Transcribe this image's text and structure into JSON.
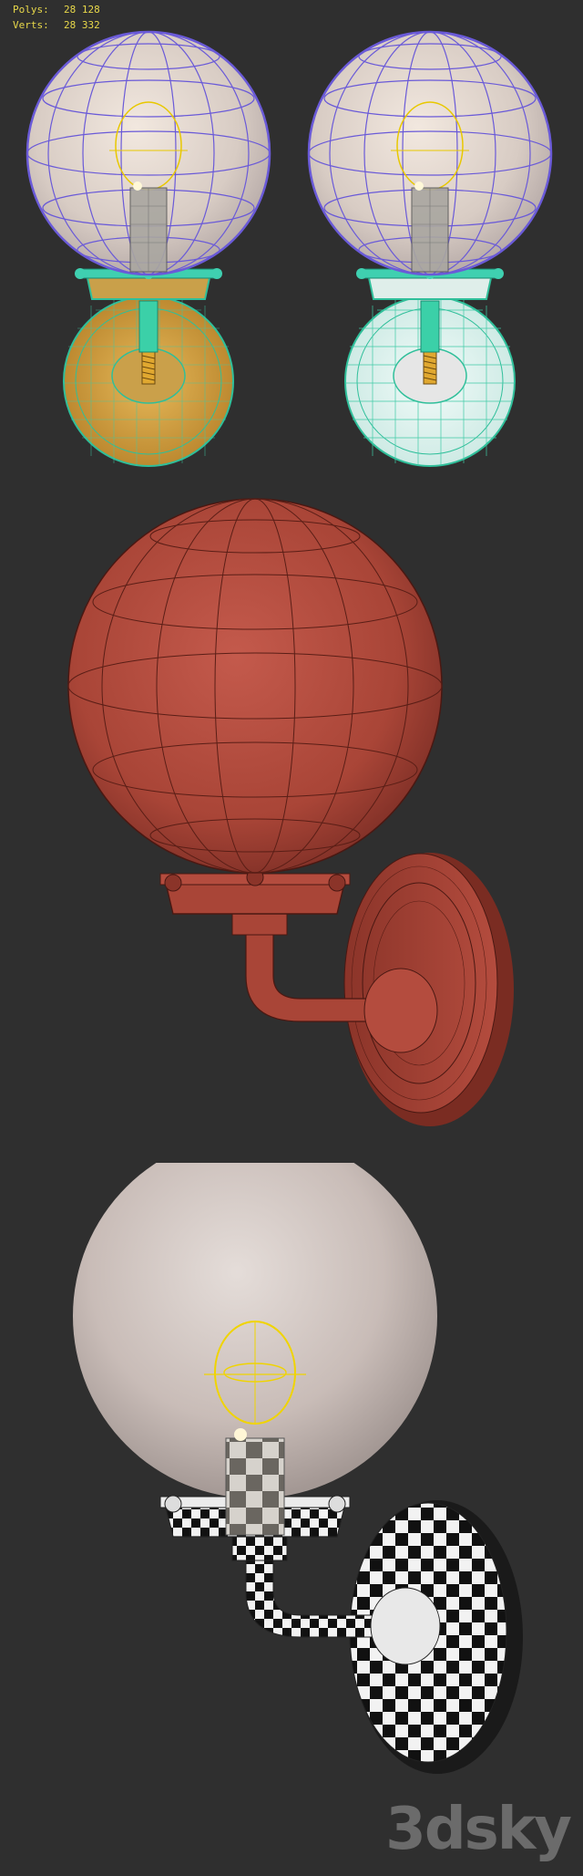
{
  "stats": {
    "polys_label": "Polys:",
    "polys_value": "28 128",
    "verts_label": "Verts:",
    "verts_value": "28 332"
  },
  "watermark": "3dsky",
  "colors": {
    "background": "#2f2f2f",
    "wire_purple": "#6a5ad8",
    "wire_cyan": "#3fd0b8",
    "wire_gold": "#d9a43a",
    "clay_red": "#b04a3e",
    "glass": "#d8ccc8",
    "filament": "#f0d400"
  }
}
